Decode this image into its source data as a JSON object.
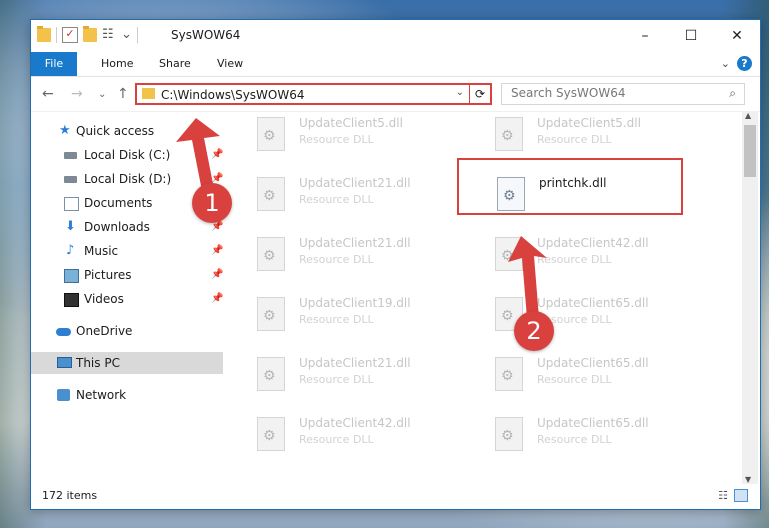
{
  "window": {
    "title": "SysWOW64",
    "icons": {
      "qat": [
        "folder-icon",
        "checkmark-icon",
        "folder-icon",
        "properties-icon"
      ],
      "minimize": "–",
      "maximize": "☐",
      "close": "✕"
    }
  },
  "ribbon": {
    "tabs": [
      "File",
      "Home",
      "Share",
      "View"
    ],
    "expand_glyph": "⌄",
    "help_glyph": "?"
  },
  "navigation": {
    "back": "←",
    "forward": "→",
    "recent": "⌄",
    "up": "↑",
    "address": "C:\\Windows\\SysWOW64",
    "dropdown_glyph": "⌄",
    "refresh_glyph": "⟳",
    "search_placeholder": "Search SysWOW64",
    "search_glyph": "⌕"
  },
  "sidebar": {
    "items": [
      {
        "label": "Quick access",
        "icon": "star-icon",
        "pinned": false
      },
      {
        "label": "Local Disk (C:)",
        "icon": "drive-icon",
        "pinned": true
      },
      {
        "label": "Local Disk (D:)",
        "icon": "drive-icon",
        "pinned": true
      },
      {
        "label": "Documents",
        "icon": "documents-icon",
        "pinned": true
      },
      {
        "label": "Downloads",
        "icon": "download-icon",
        "pinned": true
      },
      {
        "label": "Music",
        "icon": "music-icon",
        "pinned": true
      },
      {
        "label": "Pictures",
        "icon": "pictures-icon",
        "pinned": true
      },
      {
        "label": "Videos",
        "icon": "videos-icon",
        "pinned": true
      },
      {
        "label": "OneDrive",
        "icon": "cloud-icon",
        "pinned": false
      },
      {
        "label": "This PC",
        "icon": "computer-icon",
        "pinned": false,
        "selected": true
      },
      {
        "label": "Network",
        "icon": "network-icon",
        "pinned": false
      }
    ],
    "pin_glyph": "📌"
  },
  "files": [
    {
      "name": "UpdateClient5.dll",
      "type": "Resource DLL"
    },
    {
      "name": "UpdateClient5.dll",
      "type": "Resource DLL"
    },
    {
      "name": "UpdateClient21.dll",
      "type": "Resource DLL"
    },
    {
      "name": "printchk.dll",
      "type": "",
      "highlighted": true
    },
    {
      "name": "UpdateClient21.dll",
      "type": "Resource DLL"
    },
    {
      "name": "UpdateClient42.dll",
      "type": "Resource DLL"
    },
    {
      "name": "UpdateClient19.dll",
      "type": "Resource DLL"
    },
    {
      "name": "UpdateClient65.dll",
      "type": "Resource DLL"
    },
    {
      "name": "UpdateClient21.dll",
      "type": "Resource DLL"
    },
    {
      "name": "UpdateClient65.dll",
      "type": "Resource DLL"
    },
    {
      "name": "UpdateClient42.dll",
      "type": "Resource DLL"
    },
    {
      "name": "UpdateClient65.dll",
      "type": "Resource DLL"
    }
  ],
  "status": {
    "item_count": "172 items"
  },
  "annotations": {
    "step1": "1",
    "step2": "2",
    "color": "#d9413e"
  }
}
